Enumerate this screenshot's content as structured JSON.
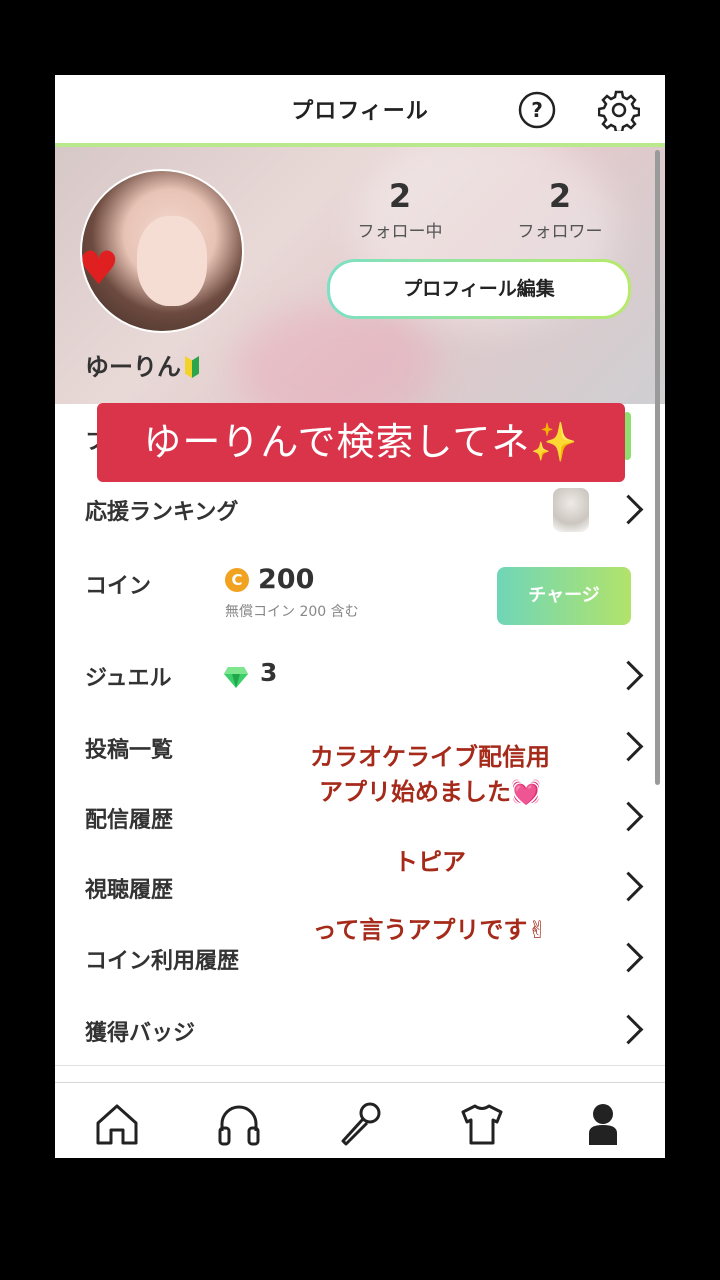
{
  "header": {
    "title": "プロフィール"
  },
  "profile": {
    "username": "ゆーりん",
    "following_count": "2",
    "following_label": "フォロー中",
    "followers_count": "2",
    "followers_label": "フォロワー",
    "edit_button": "プロフィール編集"
  },
  "menu": {
    "partial_first_letter": "フ",
    "ranking_label": "応援ランキング",
    "coin_label": "コイン",
    "coin_icon": "C",
    "coin_value": "200",
    "coin_sub": "無償コイン 200 含む",
    "charge_button": "チャージ",
    "jewel_label": "ジュエル",
    "jewel_value": "3",
    "posts_label": "投稿一覧",
    "broadcast_history_label": "配信履歴",
    "viewing_history_label": "視聴履歴",
    "coin_usage_label": "コイン利用履歴",
    "badges_label": "獲得バッジ"
  },
  "overlay": {
    "banner": "ゆーりんで検索してネ✨",
    "line1": "カラオケライブ配信用",
    "line2": "アプリ始めました💓",
    "line3": "トピア",
    "line4": "って言うアプリです✌"
  },
  "tabs": [
    "home-icon",
    "headphones-icon",
    "microphone-icon",
    "shirt-icon",
    "person-icon"
  ],
  "colors": {
    "accent_green": "#b2e36a",
    "banner_red": "#d9344a",
    "coin_orange": "#f1a220"
  }
}
